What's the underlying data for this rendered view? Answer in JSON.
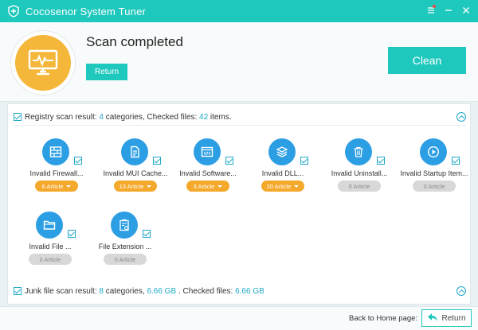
{
  "window": {
    "title": "Cocosenor System Tuner",
    "icons": {
      "app": "shield-plus-icon",
      "menu": "menu-icon",
      "minimize": "minimize-icon",
      "close": "close-icon"
    }
  },
  "header": {
    "title": "Scan completed",
    "return_label": "Return",
    "clean_label": "Clean",
    "scan_icon": "monitor-pulse-icon"
  },
  "registry": {
    "prefix": "Registry scan result: ",
    "categories_count": "4",
    "mid": " categories, Checked files: ",
    "files_count": "42",
    "suffix": " items.",
    "items": [
      {
        "label": "Invalid Firewall...",
        "count": "6 Article",
        "active": true,
        "icon": "firewall-icon"
      },
      {
        "label": "Invalid MUI Cache...",
        "count": "13 Article",
        "active": true,
        "icon": "document-icon"
      },
      {
        "label": "Invalid Software...",
        "count": "3 Article",
        "active": true,
        "icon": "code-window-icon"
      },
      {
        "label": "Invalid DLL...",
        "count": "20 Article",
        "active": true,
        "icon": "layers-icon"
      },
      {
        "label": "Invalid Uninstall...",
        "count": "0 Article",
        "active": false,
        "icon": "trash-icon"
      },
      {
        "label": "Invalid Startup Item...",
        "count": "0 Article",
        "active": false,
        "icon": "play-icon"
      },
      {
        "label": "Invalid File ...",
        "count": "0 Article",
        "active": false,
        "icon": "folder-icon"
      },
      {
        "label": "File Extension ...",
        "count": "0 Article",
        "active": false,
        "icon": "clipboard-gear-icon"
      }
    ]
  },
  "junk": {
    "prefix": "Junk file scan result: ",
    "categories_count": "8",
    "mid": " categories, ",
    "size": "6.66 GB",
    "mid2": " . Checked files: ",
    "checked": "6.66 GB"
  },
  "footer": {
    "home_label": "Back to Home page:",
    "return_label": "Return"
  },
  "colors": {
    "teal": "#1fc8bd",
    "blue": "#2c9ee4",
    "orange": "#f5a92c",
    "accent_text": "#1fa9c9"
  }
}
